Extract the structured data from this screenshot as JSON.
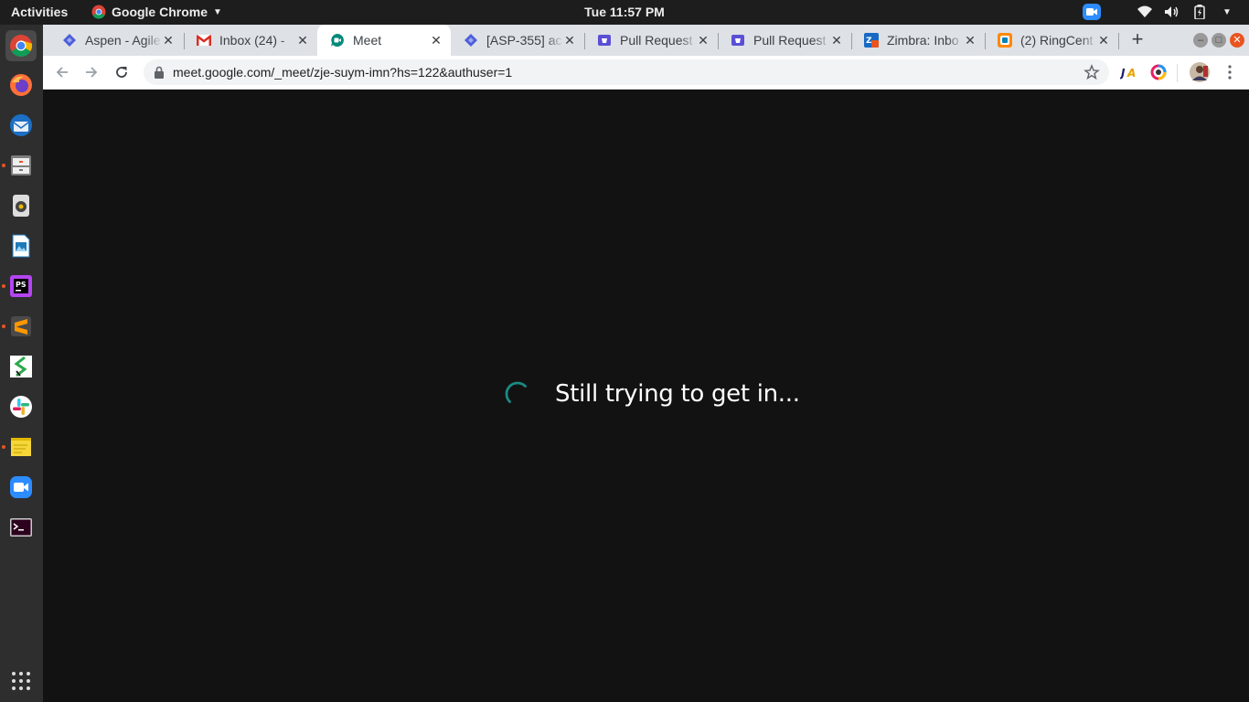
{
  "topbar": {
    "activities": "Activities",
    "app_name": "Google Chrome",
    "clock": "Tue 11:57 PM"
  },
  "tabs": [
    {
      "title": "Aspen - Agile",
      "icon": "jira-icon"
    },
    {
      "title": "Inbox (24) - ",
      "icon": "gmail-icon"
    },
    {
      "title": "Meet",
      "icon": "meet-icon"
    },
    {
      "title": "[ASP-355] ac",
      "icon": "jira-icon"
    },
    {
      "title": "Pull Request",
      "icon": "bitbucket-icon"
    },
    {
      "title": "Pull Request",
      "icon": "bitbucket-icon"
    },
    {
      "title": "Zimbra: Inbo",
      "icon": "zimbra-icon"
    },
    {
      "title": "(2) RingCent",
      "icon": "ringcentral-icon"
    }
  ],
  "toolbar": {
    "url": "meet.google.com/_meet/zje-suym-imn?hs=122&authuser=1"
  },
  "main": {
    "status_text": "Still trying to get in..."
  },
  "colors": {
    "accent_teal": "#1a8a83",
    "content_bg": "#121212",
    "ubuntu_orange": "#e95420"
  }
}
